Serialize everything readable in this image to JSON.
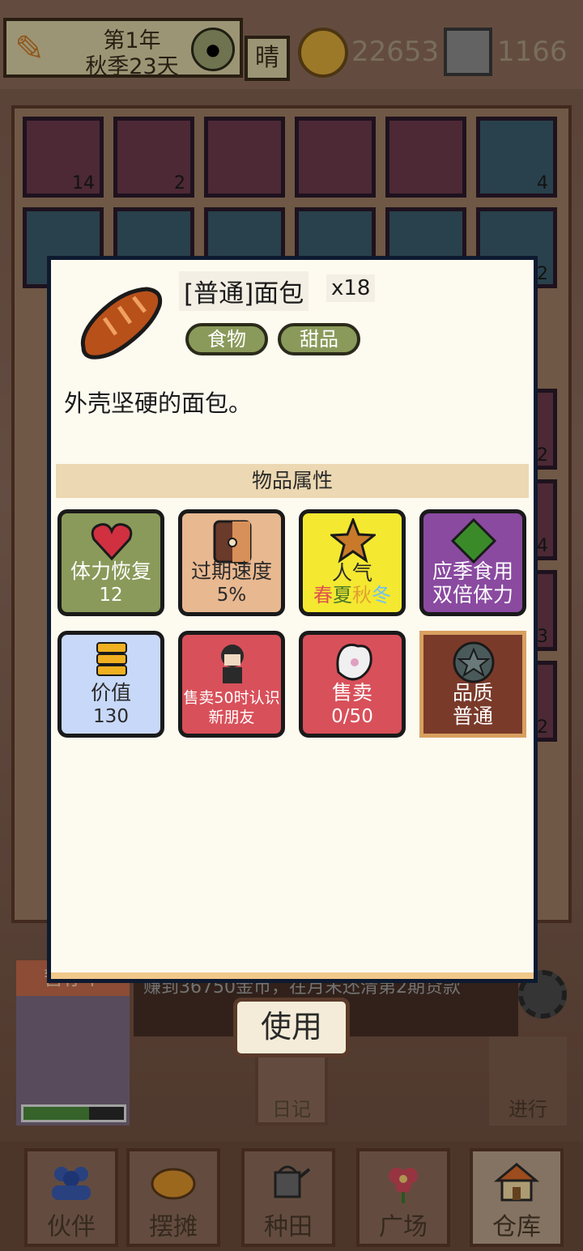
{
  "hud": {
    "year": "第1年",
    "season_day": "秋季23天",
    "weather": "晴",
    "gold": "22653",
    "gems": "1166"
  },
  "inventory": {
    "visible_counts": [
      "14",
      "2",
      "4",
      "2",
      "2",
      "4",
      "3",
      "2"
    ]
  },
  "message": {
    "badge": "暂存个",
    "text": "赚到36750金币，在月末还清第2期贷款"
  },
  "buttons": {
    "use": "使用",
    "diary": "日记",
    "next": "进行"
  },
  "stamina_fill": 0.65,
  "nav": [
    {
      "label": "伙伴",
      "icon": "people-icon"
    },
    {
      "label": "摆摊",
      "icon": "pancake-icon"
    },
    {
      "label": "种田",
      "icon": "watering-can-icon"
    },
    {
      "label": "广场",
      "icon": "flower-icon"
    },
    {
      "label": "仓库",
      "icon": "house-icon"
    }
  ],
  "item": {
    "name": "[普通]面包",
    "quantity": "x18",
    "tags": [
      "食物",
      "甜品"
    ],
    "description": "外壳坚硬的面包。",
    "section_title": "物品属性"
  },
  "properties": [
    {
      "label": "体力恢复",
      "value": "12",
      "icon": "heart-icon",
      "bg": "#8a9a5a",
      "color": "#ffffff"
    },
    {
      "label": "过期速度",
      "value": "5%",
      "icon": "clock-bag-icon",
      "bg": "#e8b890",
      "color": "#2a2a2a"
    },
    {
      "label": "人气",
      "value_seasons": [
        "春",
        "夏",
        "秋",
        "冬"
      ],
      "season_colors": [
        "#e05050",
        "#4a7a2a",
        "#e0a030",
        "#70c0f0"
      ],
      "icon": "star-icon",
      "bg": "#f4e830",
      "color": "#2a2a2a"
    },
    {
      "label": "应季食用",
      "value": "双倍体力",
      "icon": "diamond-icon",
      "bg": "#8a4aa0",
      "color": "#ffffff"
    },
    {
      "label": "价值",
      "value": "130",
      "icon": "coins-icon",
      "bg": "#c8d8f8",
      "color": "#2a2a2a"
    },
    {
      "label": "售卖50时认识新朋友",
      "icon": "character-icon",
      "bg": "#d8505a",
      "color": "#ffffff"
    },
    {
      "label": "售卖",
      "value": "0/50",
      "icon": "glove-icon",
      "bg": "#d8505a",
      "color": "#ffffff"
    },
    {
      "label": "品质",
      "value": "普通",
      "icon": "badge-icon",
      "bg": "#7a3a2a",
      "color": "#ffffff"
    }
  ]
}
